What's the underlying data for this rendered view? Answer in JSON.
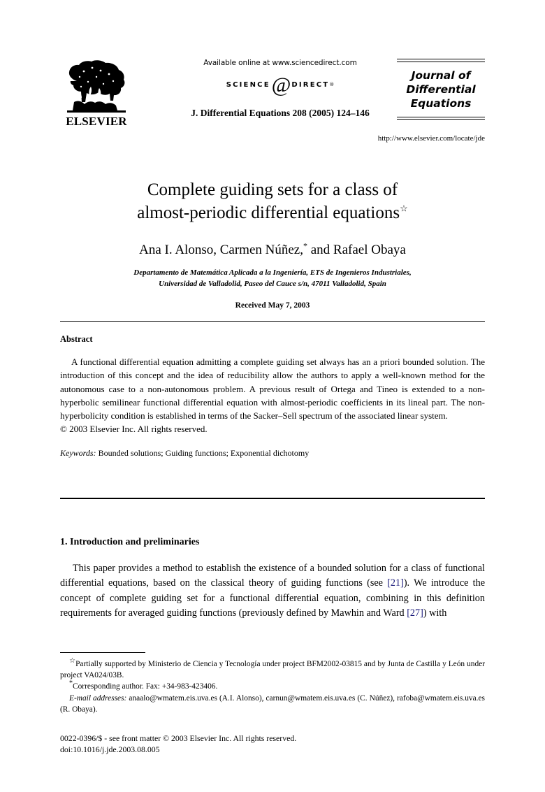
{
  "header": {
    "publisher_name": "ELSEVIER",
    "publisher_logo_icon": "elsevier-tree-icon",
    "available_online": "Available online at www.sciencedirect.com",
    "sciencedirect_left": "SCIENCE",
    "sciencedirect_at": "@",
    "sciencedirect_right": "DIRECT",
    "sciencedirect_reg": "®",
    "citation_line": "J. Differential Equations 208 (2005) 124–146",
    "journal_name": "Journal of Differential Equations",
    "journal_url": "http://www.elsevier.com/locate/jde"
  },
  "title_block": {
    "title_line_1": "Complete guiding sets for a class of",
    "title_line_2": "almost-periodic differential equations",
    "title_footnote_marker": "☆",
    "authors": "Ana I. Alonso, Carmen Núñez,",
    "authors_corresponding_marker": "*",
    "authors_tail": " and Rafael Obaya",
    "affiliation_line_1": "Departamento de Matemática Aplicada a la Ingeniería, ETS de Ingenieros Industriales,",
    "affiliation_line_2": "Universidad de Valladolid, Paseo del Cauce s/n, 47011 Valladolid, Spain",
    "received": "Received May 7, 2003"
  },
  "abstract": {
    "heading": "Abstract",
    "body": "A functional differential equation admitting a complete guiding set always has an a priori bounded solution. The introduction of this concept and the idea of reducibility allow the authors to apply a well-known method for the autonomous case to a non-autonomous problem. A previous result of Ortega and Tineo is extended to a non-hyperbolic semilinear functional differential equation with almost-periodic coefficients in its lineal part. The non-hyperbolicity condition is established in terms of the Sacker–Sell spectrum of the associated linear system.",
    "copyright": "© 2003 Elsevier Inc. All rights reserved.",
    "keywords_label": "Keywords:",
    "keywords_value": "Bounded solutions; Guiding functions; Exponential dichotomy"
  },
  "section": {
    "heading": "1. Introduction and preliminaries",
    "paragraph_part_1": "This paper provides a method to establish the existence of a bounded solution for a class of functional differential equations, based on the classical theory of guiding functions (see ",
    "citation_1": "[21]",
    "paragraph_part_2": "). We introduce the concept of complete guiding set for a functional differential equation, combining in this definition requirements for averaged guiding functions (previously defined by Mawhin and Ward ",
    "citation_2": "[27]",
    "paragraph_part_3": ") with"
  },
  "footnotes": {
    "star_marker": "☆",
    "note_1": "Partially supported by Ministerio de Ciencia y Tecnología under project BFM2002-03815 and by Junta de Castilla y León under project VA024/03B.",
    "corresponding_marker": "*",
    "note_2": "Corresponding author. Fax: +34-983-423406.",
    "email_label": "E-mail addresses:",
    "email_value": " anaalo@wmatem.eis.uva.es (A.I. Alonso), carnun@wmatem.eis.uva.es (C. Núñez), rafoba@wmatem.eis.uva.es (R. Obaya)."
  },
  "imprint": {
    "issn_line": "0022-0396/$ - see front matter © 2003 Elsevier Inc. All rights reserved.",
    "doi_line": "doi:10.1016/j.jde.2003.08.005"
  },
  "colors": {
    "text": "#000000",
    "citation_link": "#1a1a7a",
    "page_background": "#ffffff"
  }
}
